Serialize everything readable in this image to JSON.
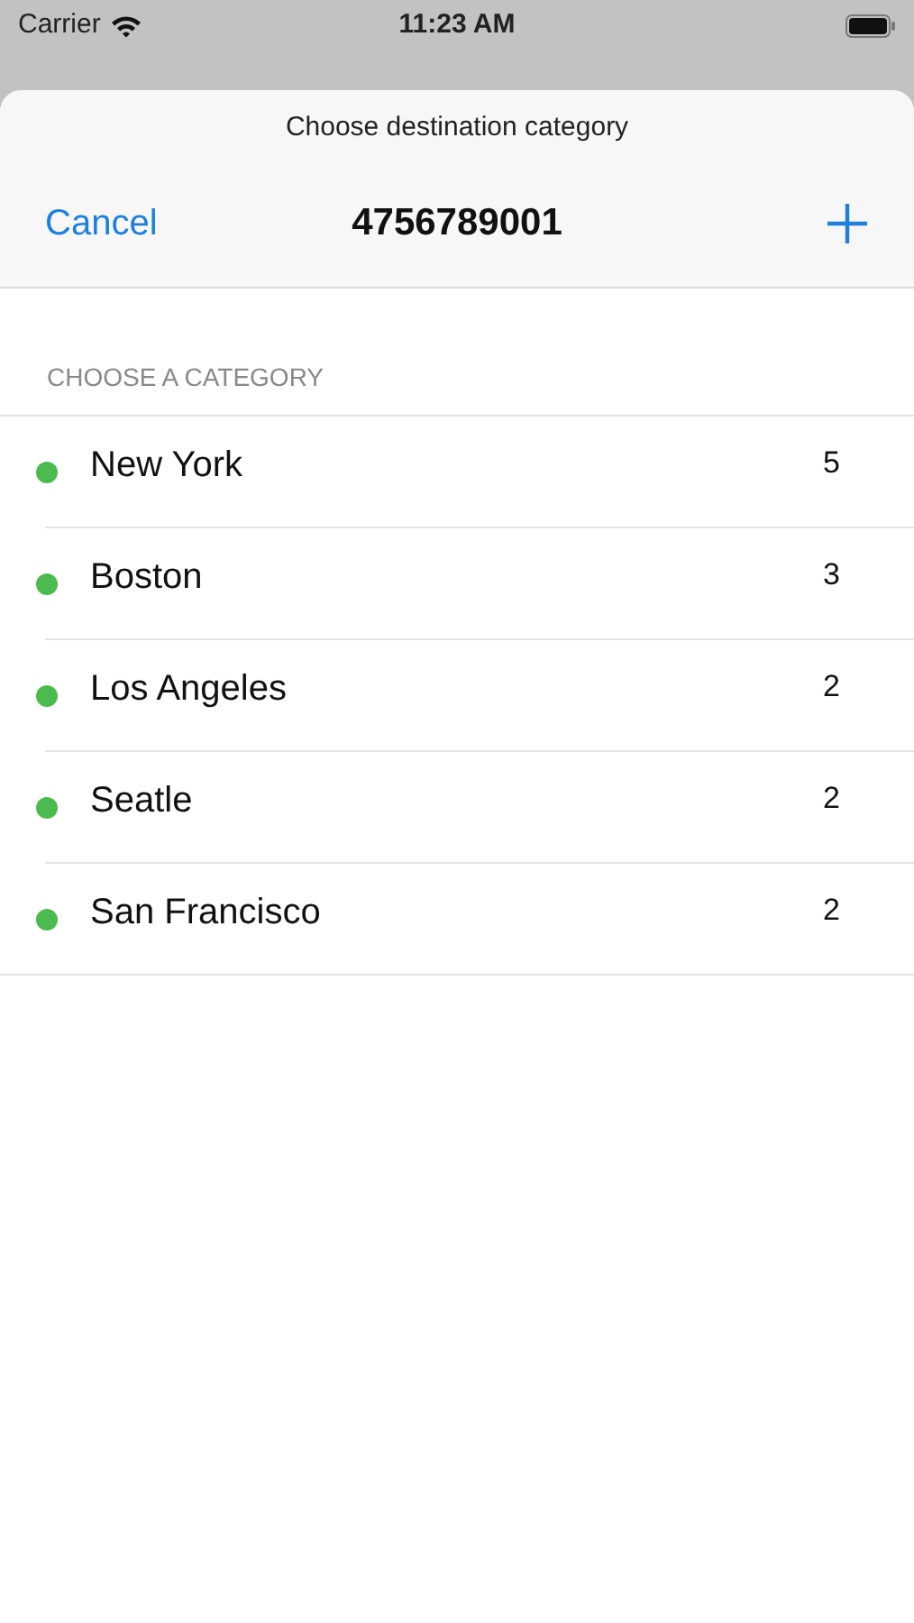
{
  "status_bar": {
    "carrier": "Carrier",
    "time": "11:23 AM"
  },
  "sheet": {
    "subtitle": "Choose destination category",
    "cancel": "Cancel",
    "title": "4756789001"
  },
  "section_header": "CHOOSE A CATEGORY",
  "categories": [
    {
      "name": "New York",
      "count": "5",
      "color": "#4cbb4f"
    },
    {
      "name": "Boston",
      "count": "3",
      "color": "#4cbb4f"
    },
    {
      "name": "Los Angeles",
      "count": "2",
      "color": "#4cbb4f"
    },
    {
      "name": "Seatle",
      "count": "2",
      "color": "#4cbb4f"
    },
    {
      "name": "San Francisco",
      "count": "2",
      "color": "#4cbb4f"
    }
  ]
}
